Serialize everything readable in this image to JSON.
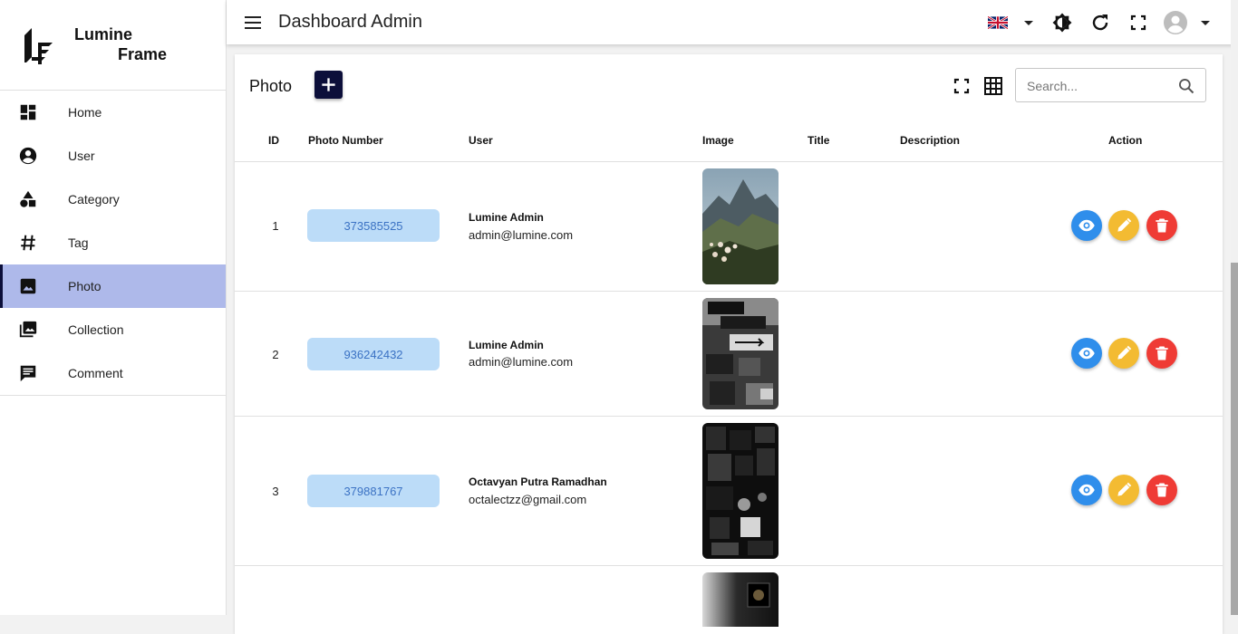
{
  "brand": {
    "line1": "Lumine",
    "line2": "Frame"
  },
  "sidebar": {
    "items": [
      {
        "label": "Home",
        "icon": "dashboard-icon",
        "active": false
      },
      {
        "label": "User",
        "icon": "account-circle-icon",
        "active": false
      },
      {
        "label": "Category",
        "icon": "shapes-icon",
        "active": false
      },
      {
        "label": "Tag",
        "icon": "hashtag-icon",
        "active": false
      },
      {
        "label": "Photo",
        "icon": "image-icon",
        "active": true
      },
      {
        "label": "Collection",
        "icon": "image-multiple-icon",
        "active": false
      },
      {
        "label": "Comment",
        "icon": "comment-icon",
        "active": false
      }
    ]
  },
  "topbar": {
    "title": "Dashboard Admin",
    "icons": [
      "uk-flag-icon",
      "chevron-down-icon",
      "theme-toggle-icon",
      "refresh-icon",
      "fullscreen-icon",
      "avatar-icon",
      "chevron-down-icon"
    ]
  },
  "card": {
    "title": "Photo",
    "search_placeholder": "Search...",
    "icons": [
      "add-icon",
      "fullscreen-icon",
      "grid-view-icon",
      "search-icon"
    ]
  },
  "table": {
    "headers": [
      "ID",
      "Photo Number",
      "User",
      "Image",
      "Title",
      "Description",
      "Action"
    ],
    "rows": [
      {
        "id": "1",
        "photo_number": "373585525",
        "user_name": "Lumine Admin",
        "user_email": "admin@lumine.com",
        "title": "",
        "description": "",
        "image": "mountain-flowers-photo"
      },
      {
        "id": "2",
        "photo_number": "936242432",
        "user_name": "Lumine Admin",
        "user_email": "admin@lumine.com",
        "title": "",
        "description": "",
        "image": "street-signs-photo"
      },
      {
        "id": "3",
        "photo_number": "379881767",
        "user_name": "Octavyan Putra Ramadhan",
        "user_email": "octalectzz@gmail.com",
        "title": "",
        "description": "",
        "image": "dark-collage-photo"
      }
    ]
  },
  "colors": {
    "primary_dark": "#0c0f3a",
    "active_nav": "#aeb9ea",
    "badge_bg": "#bcdcf8",
    "badge_text": "#3b72c4",
    "view": "#2f8eeb",
    "edit": "#f3bb32",
    "delete": "#ef3b35"
  }
}
